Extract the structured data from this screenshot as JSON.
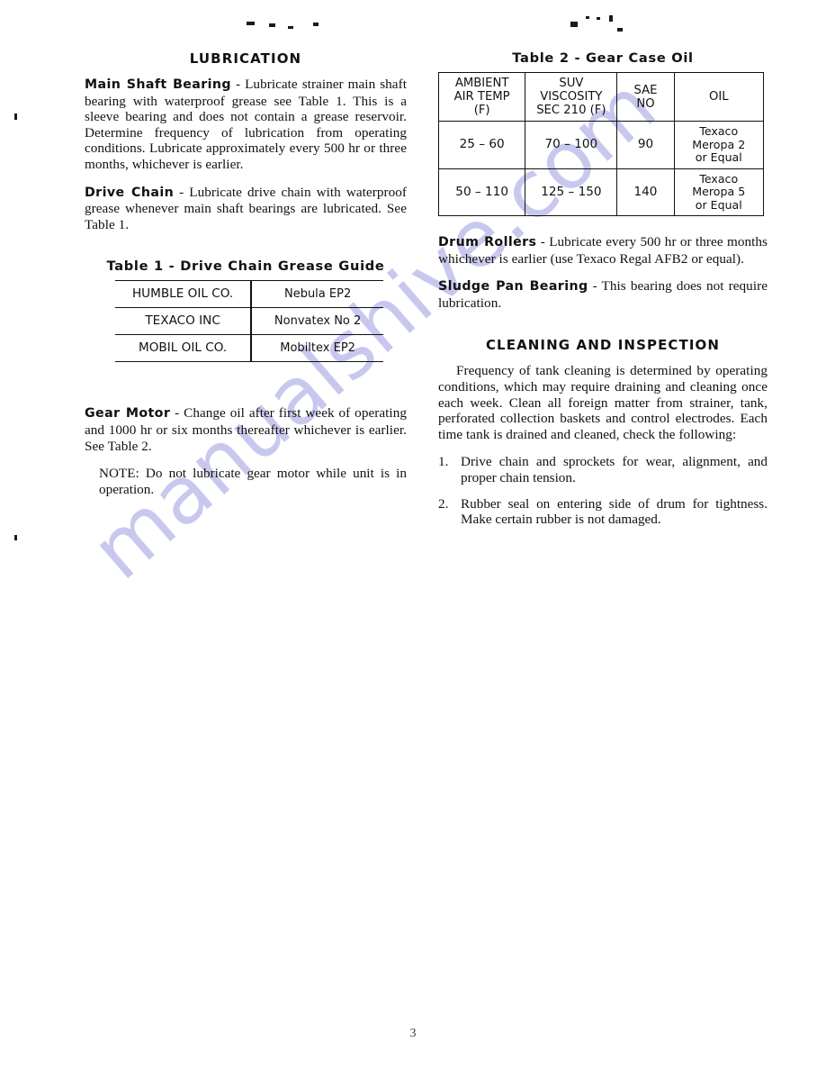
{
  "page": {
    "number": "3",
    "watermark_text": "manualshive.com"
  },
  "left_column": {
    "section_title": "LUBRICATION",
    "main_shaft_bearing": {
      "heading": "Main Shaft Bearing",
      "dash": " - ",
      "text": "Lubricate strainer main shaft bearing with waterproof grease see Table 1. This is a sleeve bearing and does not contain a grease reservoir. Determine frequency of lubrication from operating conditions. Lubricate approximately every 500 hr or three months, whichever is earlier."
    },
    "drive_chain": {
      "heading": "Drive Chain",
      "dash": " - ",
      "text": "Lubricate drive chain with waterproof grease whenever main shaft bearings are lubricated. See Table 1."
    },
    "table1": {
      "caption": "Table 1 - Drive Chain Grease Guide",
      "rows": [
        {
          "supplier": "HUMBLE OIL CO.",
          "grease": "Nebula EP2"
        },
        {
          "supplier": "TEXACO INC",
          "grease": "Nonvatex No  2"
        },
        {
          "supplier": "MOBIL OIL CO.",
          "grease": "Mobiltex EP2"
        }
      ]
    },
    "gear_motor": {
      "heading": "Gear Motor",
      "dash": " - ",
      "text": "Change oil after first week of operating and 1000 hr or six months thereafter whichever is earlier. See Table 2."
    },
    "note": "NOTE: Do not lubricate gear motor while unit is in operation."
  },
  "right_column": {
    "table2": {
      "caption": "Table 2 - Gear Case Oil",
      "headers": [
        "AMBIENT\nAIR TEMP (F)",
        "SUV VISCOSITY\nSEC 210 (F)",
        "SAE NO",
        "OIL"
      ],
      "headers_flat": {
        "h1_line1": "AMBIENT",
        "h1_line2": "AIR TEMP (F)",
        "h2_line1": "SUV VISCOSITY",
        "h2_line2": "SEC 210 (F)",
        "h3": "SAE NO",
        "h4": "OIL"
      },
      "rows": [
        {
          "ambient_air_temp": "25 –   60",
          "suv_viscosity": "70 – 100",
          "sae_no": "90",
          "oil_line1": "Texaco Meropa 2",
          "oil_line2": "or Equal"
        },
        {
          "ambient_air_temp": "50 – 110",
          "suv_viscosity": "125 – 150",
          "sae_no": "140",
          "oil_line1": "Texaco Meropa 5",
          "oil_line2": "or Equal"
        }
      ]
    },
    "drum_rollers": {
      "heading": "Drum Rollers",
      "dash": " - ",
      "text": "Lubricate every 500 hr or three months whichever is earlier (use Texaco Regal AFB2 or equal)."
    },
    "sludge_pan_bearing": {
      "heading": "Sludge Pan Bearing",
      "dash": " - ",
      "text": "This bearing does not require lubrication."
    },
    "section_title": "CLEANING AND INSPECTION",
    "cleaning_intro": "Frequency of tank cleaning is determined by operating conditions, which may require draining and cleaning once each week. Clean all foreign matter from strainer, tank, perforated collection baskets and control electrodes. Each time tank is drained and cleaned, check the following:",
    "checklist": [
      {
        "num": "1.",
        "text": "Drive chain and sprockets for wear, alignment, and proper chain tension."
      },
      {
        "num": "2.",
        "text": "Rubber seal on entering side of drum for tightness. Make certain rubber is not damaged."
      }
    ]
  }
}
